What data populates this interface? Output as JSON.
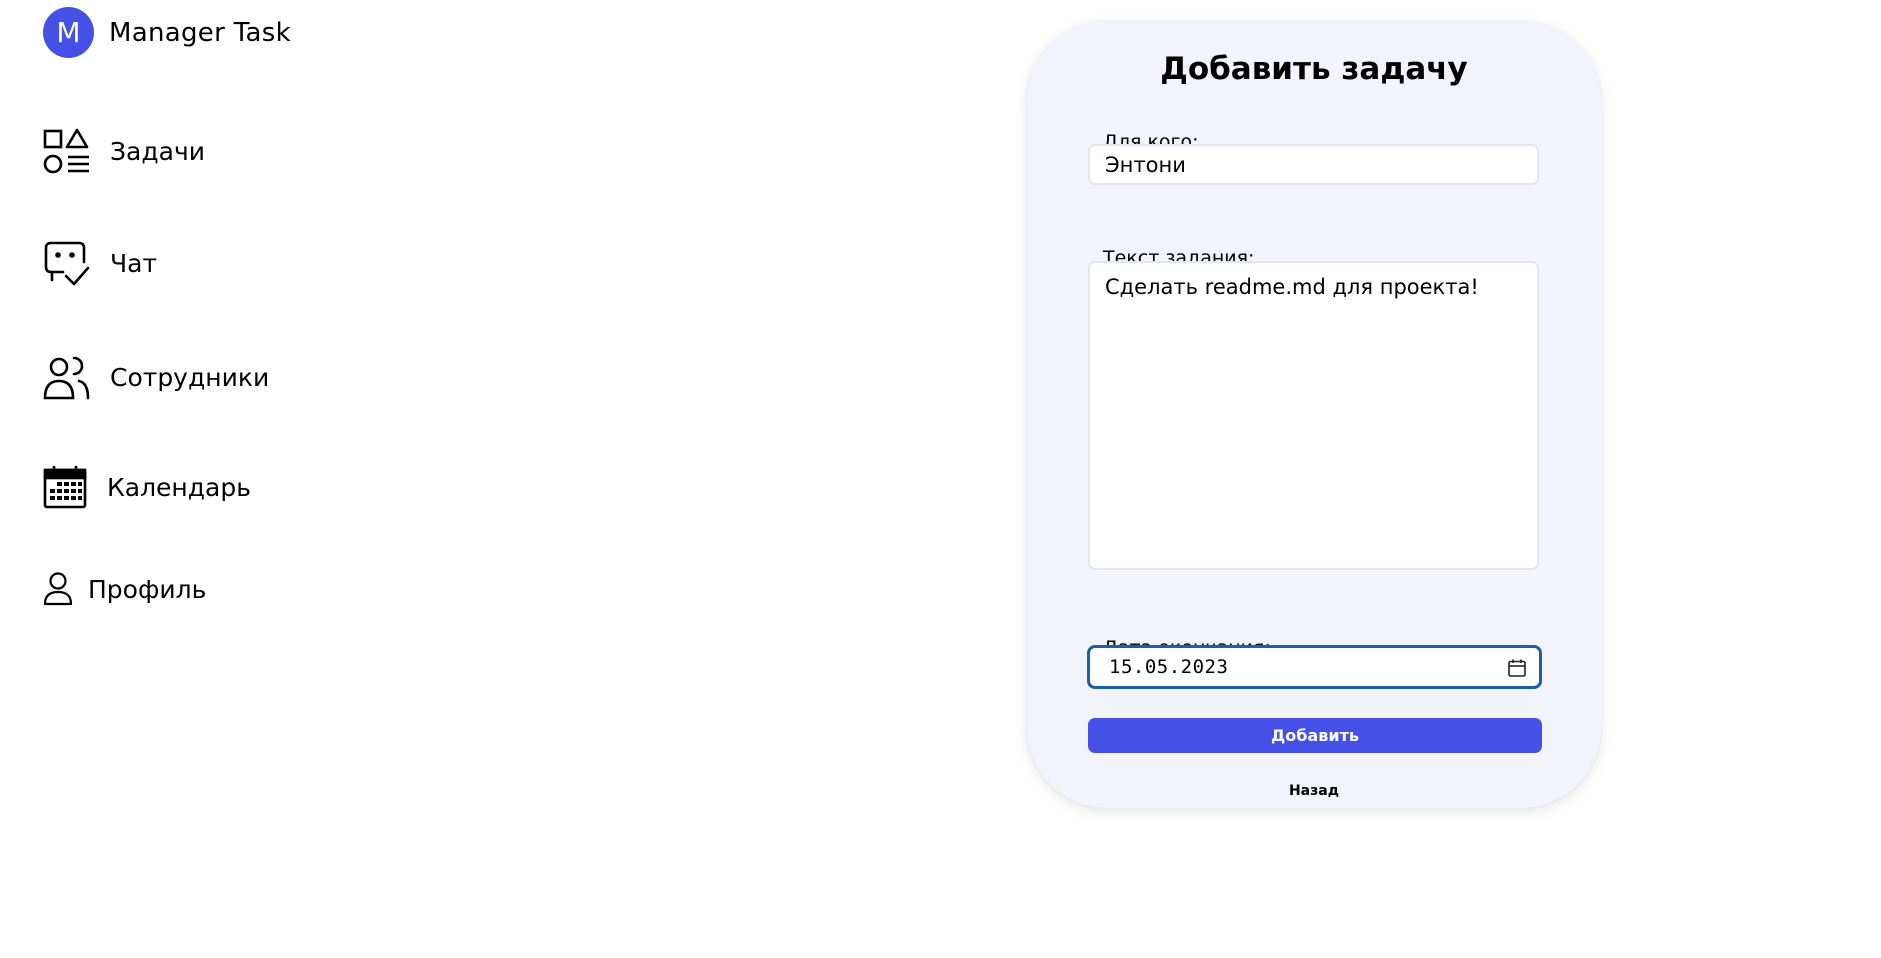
{
  "brand": {
    "initial": "M",
    "title": "Manager Task",
    "avatar_color": "#4450e6"
  },
  "sidebar": {
    "items": [
      {
        "label": "Задачи",
        "icon": "shapes-list-icon"
      },
      {
        "label": "Чат",
        "icon": "chat-check-icon"
      },
      {
        "label": "Сотрудники",
        "icon": "users-icon"
      },
      {
        "label": "Календарь",
        "icon": "calendar-icon"
      },
      {
        "label": "Профиль",
        "icon": "user-icon"
      }
    ]
  },
  "form": {
    "title": "Добавить задачу",
    "recipient_label": "Для кого:",
    "recipient_value": "Энтони",
    "task_label": "Текст задания:",
    "task_value": "Сделать readme.md для проекта!",
    "date_label": "Дата окончания:",
    "date_value": "15.05.2023",
    "submit_label": "Добавить",
    "back_label": "Назад",
    "accent_color": "#4450e6",
    "card_background": "#f2f3fb"
  }
}
